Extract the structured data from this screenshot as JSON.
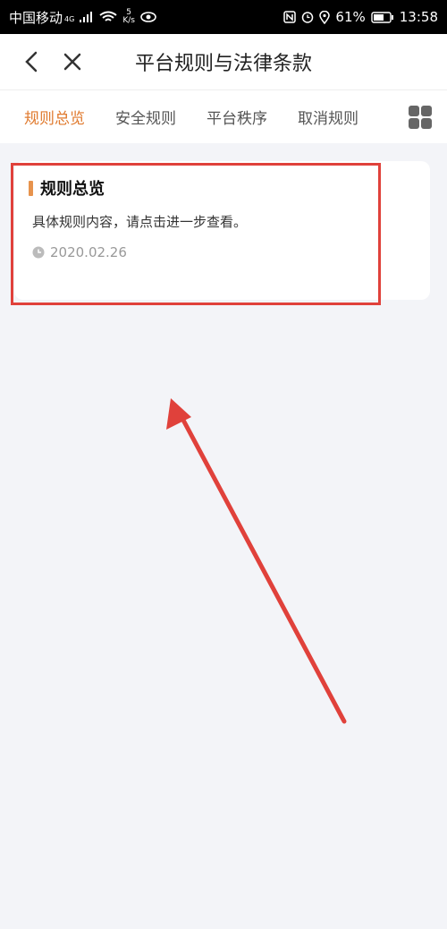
{
  "status_bar": {
    "carrier": "中国移动",
    "network": "4G",
    "speed_value": "5",
    "speed_unit": "K/s",
    "battery": "61%",
    "time": "13:58"
  },
  "nav": {
    "title": "平台规则与法律条款"
  },
  "tabs": [
    {
      "label": "规则总览",
      "active": true
    },
    {
      "label": "安全规则",
      "active": false
    },
    {
      "label": "平台秩序",
      "active": false
    },
    {
      "label": "取消规则",
      "active": false
    }
  ],
  "card": {
    "title": "规则总览",
    "description": "具体规则内容，请点击进一步查看。",
    "date": "2020.02.26"
  },
  "colors": {
    "accent": "#e07a2e",
    "annotation": "#e0413b"
  }
}
